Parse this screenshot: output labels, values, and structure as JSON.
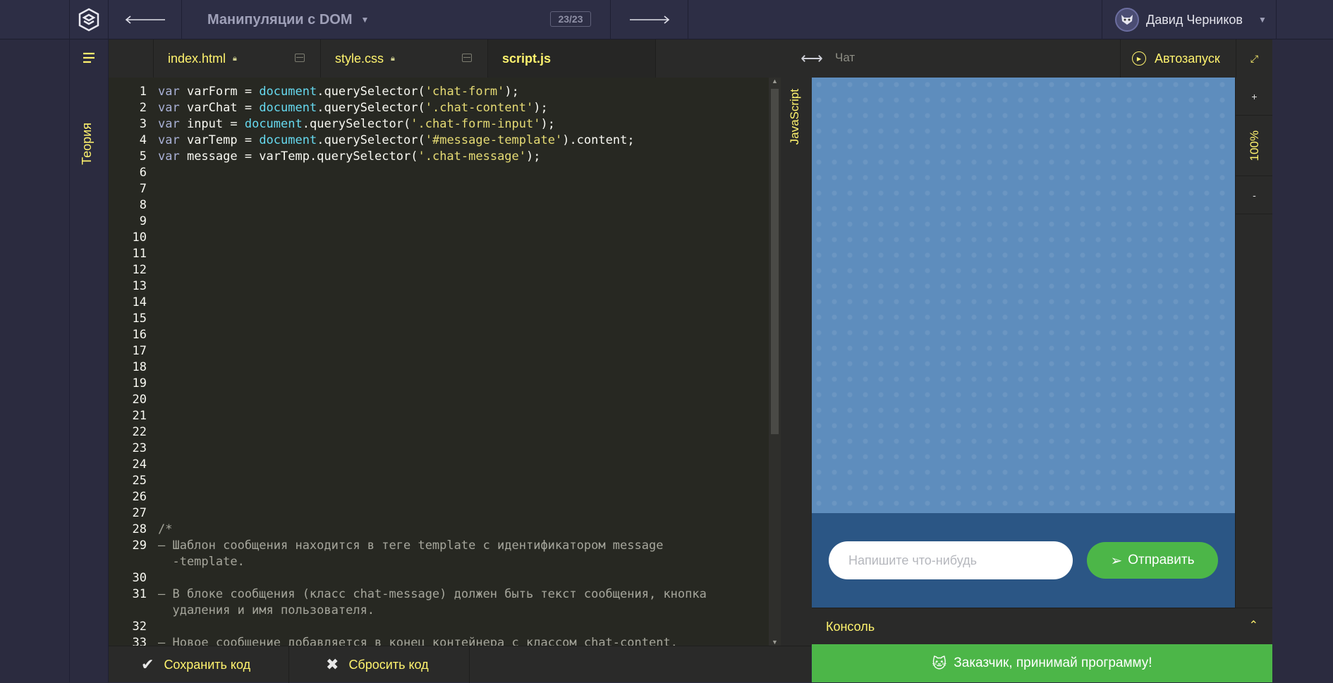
{
  "topbar": {
    "lesson_title": "Манипуляции с DOM",
    "counter": "23/23",
    "user_name": "Давид Черников",
    "prev_icon": "arrow-left-icon",
    "next_icon": "arrow-right-icon"
  },
  "sidebar": {
    "theory_label": "Теория"
  },
  "tabs": [
    {
      "label": "index.html"
    },
    {
      "label": "style.css"
    },
    {
      "label": "script.js"
    }
  ],
  "editor": {
    "language_label": "JavaScript",
    "line_numbers": [
      "1",
      "2",
      "3",
      "4",
      "5",
      "6",
      "7",
      "8",
      "9",
      "10",
      "11",
      "12",
      "13",
      "14",
      "15",
      "16",
      "17",
      "18",
      "19",
      "20",
      "21",
      "22",
      "23",
      "24",
      "25",
      "26",
      "27",
      "28",
      "29",
      "30",
      "31",
      "32",
      "33"
    ],
    "code": [
      [
        "var",
        " varForm = ",
        "document",
        ".querySelector(",
        "'chat-form'",
        ");"
      ],
      [
        "var",
        " varChat = ",
        "document",
        ".querySelector(",
        "'.chat-content'",
        ");"
      ],
      [
        "var",
        " input = ",
        "document",
        ".querySelector(",
        "'.chat-form-input'",
        ");"
      ],
      [
        "var",
        " varTemp = ",
        "document",
        ".querySelector(",
        "'#message-template'",
        ").content;"
      ],
      [
        "var",
        " message = varTemp.querySelector(",
        "",
        "",
        "'.chat-message'",
        ");"
      ]
    ],
    "comments": [
      "/*",
      "— Шаблон сообщения находится в теге template с идентификатором message",
      "  -template.",
      "— В блоке сообщения (класс chat-message) должен быть текст сообщения, кнопка",
      "  удаления и имя пользователя.",
      "— Новое сообщение добавляется в конец контейнера с классом chat-content."
    ]
  },
  "bottombar": {
    "save_label": "Сохранить код",
    "reset_label": "Сбросить код"
  },
  "preview": {
    "title": "Чат",
    "autorun_label": "Автозапуск",
    "zoom": "100%",
    "zoom_in": "+",
    "zoom_out": "-",
    "input_placeholder": "Напишите что-нибудь",
    "send_label": "Отправить",
    "console_label": "Консоль",
    "accept_label": "Заказчик, принимай программу!"
  },
  "colors": {
    "accent": "#fff36e",
    "chat_bg": "#5e8dbd",
    "form_bg": "#2b5685",
    "green": "#4cb648"
  }
}
